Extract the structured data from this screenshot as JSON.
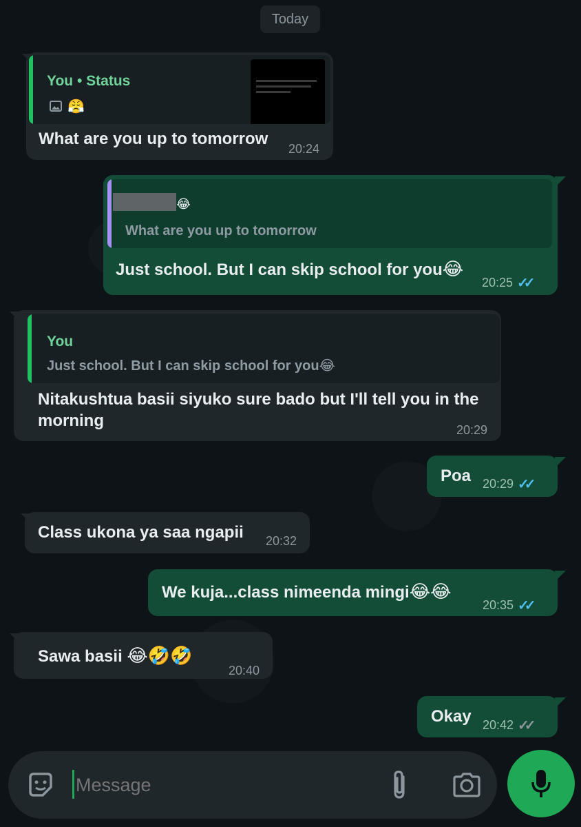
{
  "date_chip": "Today",
  "messages": [
    {
      "direction": "incoming",
      "quote": {
        "author": "You",
        "separator": "•",
        "kind": "Status",
        "icons": "image-icon, crying-face"
      },
      "text": "What are you up to tomorrow",
      "time": "20:24"
    },
    {
      "direction": "outgoing",
      "quote": {
        "author": "",
        "text": "What are you up to tomorrow"
      },
      "text": "Just school. But I can skip school for you",
      "emoji": "😂",
      "time": "20:25",
      "status": "read"
    },
    {
      "direction": "incoming",
      "quote": {
        "author": "You",
        "text": "Just school. But I can skip school for you",
        "emoji": "😂"
      },
      "text_line1": "Nitakushtua basii siyuko sure bado but I'll tell you in the",
      "text_line2": "morning",
      "time": "20:29"
    },
    {
      "direction": "outgoing",
      "text": "Poa",
      "time": "20:29",
      "status": "read"
    },
    {
      "direction": "incoming",
      "text": "Class ukona ya saa ngapii",
      "time": "20:32"
    },
    {
      "direction": "outgoing",
      "text": "We kuja...class nimeenda mingi",
      "emoji": "😂😂",
      "time": "20:35",
      "status": "read"
    },
    {
      "direction": "incoming",
      "text": "Sawa basii",
      "emoji": "😂🤣🤣",
      "time": "20:40"
    },
    {
      "direction": "outgoing",
      "text": "Okay",
      "time": "20:42",
      "status": "delivered"
    }
  ],
  "composer": {
    "placeholder": "Message",
    "icons": [
      "sticker-icon",
      "paperclip-icon",
      "camera-icon",
      "microphone-icon"
    ]
  },
  "colors": {
    "incoming_bubble": "#1f272b",
    "outgoing_bubble": "#134d37",
    "accent_green": "#1fa855",
    "read_tick": "#53bdeb",
    "quote_bar_self": "#21c063",
    "quote_bar_other": "#a791f3"
  }
}
